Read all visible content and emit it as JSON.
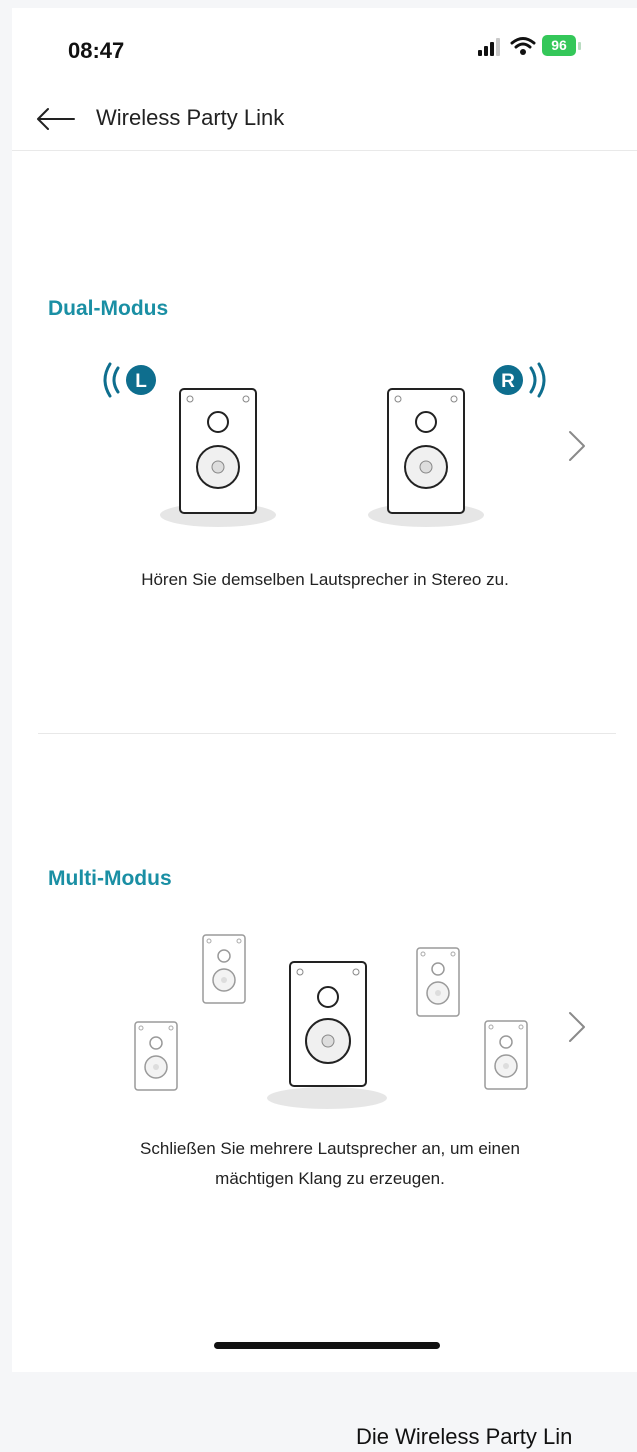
{
  "status_bar": {
    "time": "08:47",
    "battery": "96",
    "icons": [
      "signal-icon",
      "wifi-icon",
      "battery-charging-icon"
    ]
  },
  "header": {
    "title": "Wireless Party Link",
    "back_icon": "back-arrow-icon"
  },
  "modes": [
    {
      "title": "Dual-Modus",
      "left_badge": "L",
      "right_badge": "R",
      "description": "Hören Sie demselben Lautsprecher in Stereo zu."
    },
    {
      "title": "Multi-Modus",
      "description_line1": "Schließen Sie mehrere Lautsprecher an, um einen",
      "description_line2": "mächtigen Klang zu erzeugen."
    }
  ],
  "footer": {
    "text": "Die Wireless Party Lin"
  },
  "colors": {
    "accent": "#1a8fa4",
    "badge": "#0e6e8e",
    "battery": "#34c759"
  }
}
